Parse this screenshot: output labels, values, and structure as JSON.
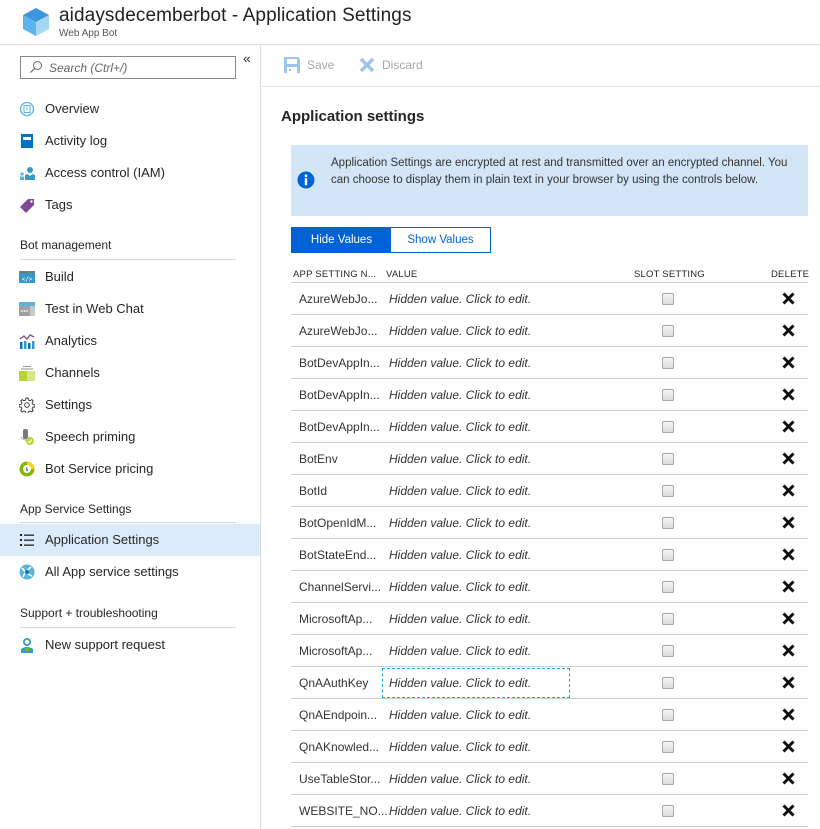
{
  "header": {
    "title": "aidaysdecemberbot - Application Settings",
    "subtitle": "Web App Bot",
    "logo_icon": "cube-icon"
  },
  "sidebar": {
    "search_placeholder": "Search (Ctrl+/)",
    "collapse_label": "«",
    "items_top": [
      {
        "label": "Overview",
        "icon": "overview-icon"
      },
      {
        "label": "Activity log",
        "icon": "activity-log-icon"
      },
      {
        "label": "Access control (IAM)",
        "icon": "access-control-icon"
      },
      {
        "label": "Tags",
        "icon": "tag-icon"
      }
    ],
    "sections": [
      {
        "title": "Bot management",
        "items": [
          {
            "label": "Build",
            "icon": "code-icon"
          },
          {
            "label": "Test in Web Chat",
            "icon": "web-chat-icon"
          },
          {
            "label": "Analytics",
            "icon": "analytics-icon"
          },
          {
            "label": "Channels",
            "icon": "channels-icon"
          },
          {
            "label": "Settings",
            "icon": "gear-icon"
          },
          {
            "label": "Speech priming",
            "icon": "microphone-icon"
          },
          {
            "label": "Bot Service pricing",
            "icon": "pricing-icon"
          }
        ]
      },
      {
        "title": "App Service Settings",
        "items": [
          {
            "label": "Application Settings",
            "icon": "list-icon",
            "active": true
          },
          {
            "label": "All App service settings",
            "icon": "app-service-icon"
          }
        ]
      },
      {
        "title": "Support + troubleshooting",
        "items": [
          {
            "label": "New support request",
            "icon": "support-person-icon"
          }
        ]
      }
    ]
  },
  "toolbar": {
    "save_label": "Save",
    "discard_label": "Discard"
  },
  "main": {
    "title": "Application settings",
    "info_text": "Application Settings are encrypted at rest and transmitted over an encrypted channel. You can choose to display them in plain text in your browser by using the controls below.",
    "toggle": {
      "hide_label": "Hide Values",
      "show_label": "Show Values",
      "selected": "Hide Values"
    },
    "table": {
      "columns": [
        "APP SETTING N...",
        "VALUE",
        "SLOT SETTING",
        "DELETE"
      ],
      "rows": [
        {
          "name": "AzureWebJo...",
          "value": "Hidden value. Click to edit.",
          "slot": false
        },
        {
          "name": "AzureWebJo...",
          "value": "Hidden value. Click to edit.",
          "slot": false
        },
        {
          "name": "BotDevAppIn...",
          "value": "Hidden value. Click to edit.",
          "slot": false
        },
        {
          "name": "BotDevAppIn...",
          "value": "Hidden value. Click to edit.",
          "slot": false
        },
        {
          "name": "BotDevAppIn...",
          "value": "Hidden value. Click to edit.",
          "slot": false
        },
        {
          "name": "BotEnv",
          "value": "Hidden value. Click to edit.",
          "slot": false
        },
        {
          "name": "BotId",
          "value": "Hidden value. Click to edit.",
          "slot": false
        },
        {
          "name": "BotOpenIdM...",
          "value": "Hidden value. Click to edit.",
          "slot": false
        },
        {
          "name": "BotStateEnd...",
          "value": "Hidden value. Click to edit.",
          "slot": false
        },
        {
          "name": "ChannelServi...",
          "value": "Hidden value. Click to edit.",
          "slot": false
        },
        {
          "name": "MicrosoftAp...",
          "value": "Hidden value. Click to edit.",
          "slot": false
        },
        {
          "name": "MicrosoftAp...",
          "value": "Hidden value. Click to edit.",
          "slot": false
        },
        {
          "name": "QnAAuthKey",
          "value": "Hidden value. Click to edit.",
          "slot": false,
          "focused": true
        },
        {
          "name": "QnAEndpoin...",
          "value": "Hidden value. Click to edit.",
          "slot": false
        },
        {
          "name": "QnAKnowled...",
          "value": "Hidden value. Click to edit.",
          "slot": false
        },
        {
          "name": "UseTableStor...",
          "value": "Hidden value. Click to edit.",
          "slot": false
        },
        {
          "name": "WEBSITE_NO...",
          "value": "Hidden value. Click to edit.",
          "slot": false
        }
      ]
    }
  }
}
